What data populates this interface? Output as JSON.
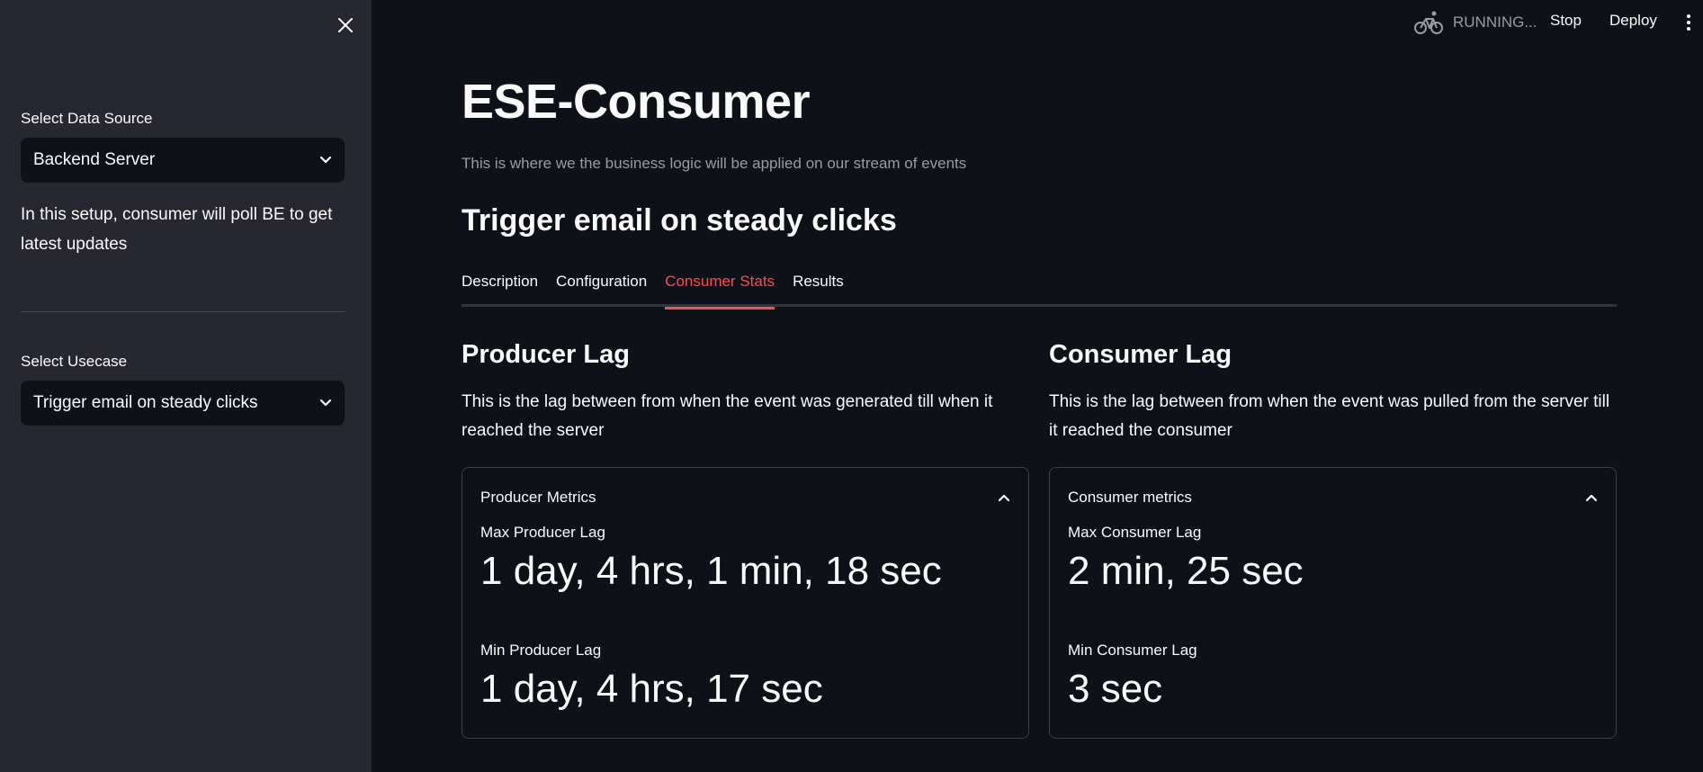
{
  "sidebar": {
    "data_source": {
      "label": "Select Data Source",
      "value": "Backend Server"
    },
    "info": "In this setup, consumer will poll BE to get latest updates",
    "usecase": {
      "label": "Select Usecase",
      "value": "Trigger email on steady clicks"
    }
  },
  "topbar": {
    "status": "RUNNING...",
    "stop_label": "Stop",
    "deploy_label": "Deploy"
  },
  "main": {
    "title": "ESE-Consumer",
    "caption": "This is where we the business logic will be applied on our stream of events",
    "subtitle": "Trigger email on steady clicks",
    "tabs": [
      {
        "label": "Description",
        "active": false
      },
      {
        "label": "Configuration",
        "active": false
      },
      {
        "label": "Consumer Stats",
        "active": true
      },
      {
        "label": "Results",
        "active": false
      }
    ],
    "producer": {
      "heading": "Producer Lag",
      "description": "This is the lag between from when the event was generated till when it reached the server",
      "expander_title": "Producer Metrics",
      "max_label": "Max Producer Lag",
      "max_value": "1 day, 4 hrs, 1 min, 18 sec",
      "min_label": "Min Producer Lag",
      "min_value": "1 day, 4 hrs, 17 sec"
    },
    "consumer": {
      "heading": "Consumer Lag",
      "description": "This is the lag between from when the event was pulled from the server till it reached the consumer",
      "expander_title": "Consumer metrics",
      "max_label": "Max Consumer Lag",
      "max_value": "2 min, 25 sec",
      "min_label": "Min Consumer Lag",
      "min_value": "3 sec"
    }
  },
  "colors": {
    "background": "#0e1117",
    "sidebar": "#262730",
    "accent": "#ff4b4b",
    "muted_text": "#9a9ba3"
  },
  "icons": {
    "close": "close-icon",
    "chevron": "chevron-down-icon",
    "running": "bicycle-icon",
    "menu": "kebab-menu-icon",
    "collapse": "chevron-up-icon"
  }
}
